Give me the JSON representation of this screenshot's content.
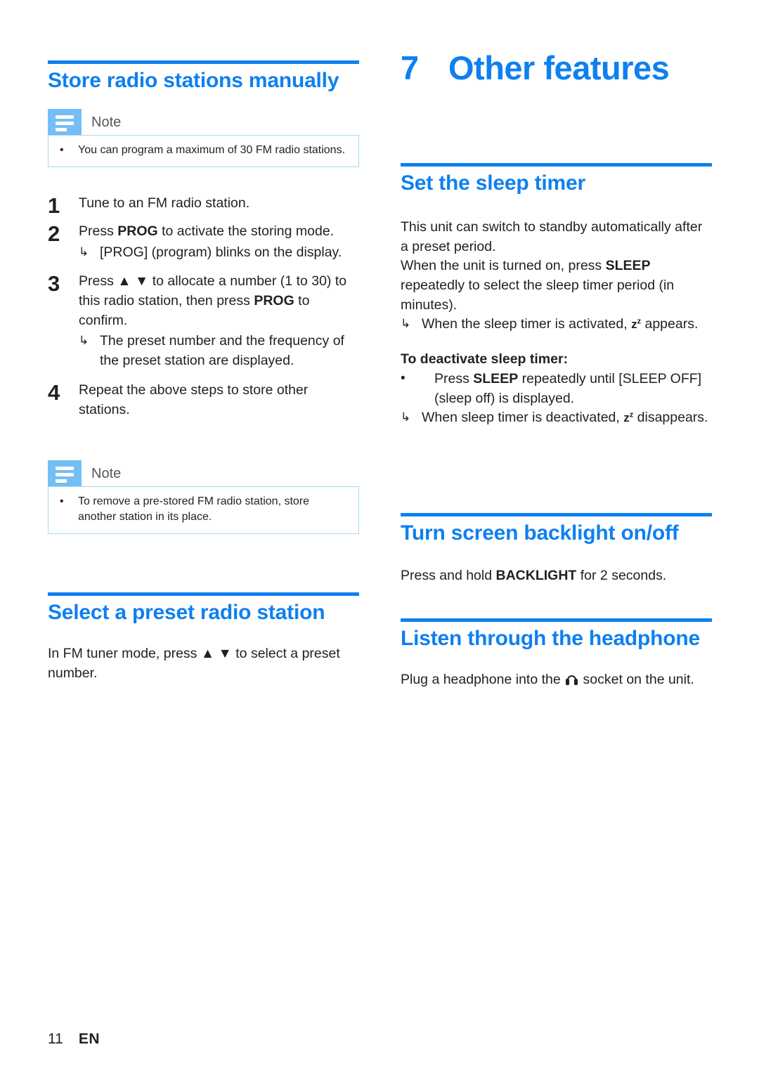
{
  "page": {
    "number": "11",
    "language": "EN"
  },
  "left_column": {
    "section1": {
      "title": "Store radio stations manually",
      "note_top": {
        "label": "Note",
        "icon": "note-lines-icon",
        "bullet": "•",
        "items": [
          "You can program a maximum of 30 FM radio stations."
        ]
      },
      "steps": [
        {
          "num": "1",
          "text": "Tune to an FM radio station.",
          "results": []
        },
        {
          "num": "2",
          "text_pre": "Press ",
          "text_bold": "PROG",
          "text_post": " to activate the storing mode.",
          "results": [
            "[PROG] (program) blinks on the display."
          ]
        },
        {
          "num": "3",
          "text_a": "Press ▲ ▼ to allocate a number (1 to 30) to this radio station, then press ",
          "text_bold": "PROG",
          "text_b": " to confirm.",
          "results": [
            "The preset number and the frequency of the preset station are displayed."
          ]
        },
        {
          "num": "4",
          "text": "Repeat the above steps to store other stations.",
          "results": []
        }
      ],
      "note_bottom": {
        "label": "Note",
        "icon": "note-lines-icon",
        "bullet": "•",
        "items": [
          "To remove a pre-stored FM radio station, store another station in its place."
        ]
      }
    },
    "section2": {
      "title": "Select a preset radio station",
      "body": "In FM tuner mode, press ▲ ▼ to select a preset number."
    }
  },
  "right_column": {
    "chapter": {
      "number": "7",
      "title": "Other features"
    },
    "section_sleep": {
      "title": "Set the sleep timer",
      "para1": "This unit can switch to standby automatically after a preset period.",
      "para2_pre": "When the unit is turned on, press ",
      "para2_bold": "SLEEP",
      "para2_post": " repeatedly to select the sleep timer period (in minutes).",
      "result1_pre": "When the sleep timer is activated, ",
      "result1_symbol": "z",
      "result1_symbol_sup": "z",
      "result1_post": " appears.",
      "deactivate_heading": "To deactivate sleep timer:",
      "deactivate_bullet": "•",
      "deactivate_pre": "Press ",
      "deactivate_bold": "SLEEP",
      "deactivate_mid": " repeatedly until ",
      "deactivate_bracket": "[SLEEP OFF]",
      "deactivate_post": " (sleep off) is displayed.",
      "result2_pre": "When sleep timer is deactivated, ",
      "result2_symbol": "z",
      "result2_symbol_sup": "z",
      "result2_post": " disappears."
    },
    "section_backlight": {
      "title": "Turn screen backlight on/off",
      "body_pre": "Press and hold ",
      "body_bold": "BACKLIGHT",
      "body_post": " for 2 seconds."
    },
    "section_headphone": {
      "title": "Listen through the headphone",
      "body_pre": "Plug a headphone into the ",
      "body_icon": "headphone-icon",
      "body_post": " socket on the unit."
    }
  },
  "colors": {
    "accent_blue": "#0e80f0",
    "note_icon_blue": "#74bdf5",
    "note_border_blue": "#a8d8f5",
    "text_black": "#231f20",
    "note_label_grey": "#58585b"
  },
  "arrow_glyph": "↳",
  "triangle_up": "▲",
  "triangle_down": "▼"
}
